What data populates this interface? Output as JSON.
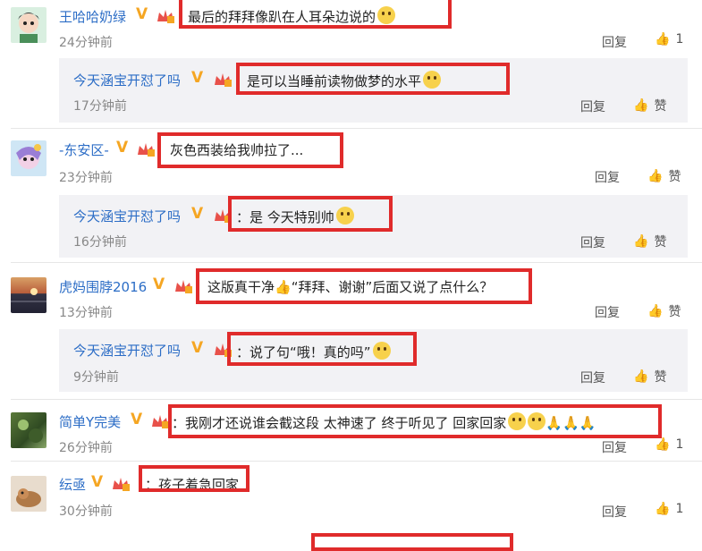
{
  "comments": [
    {
      "user": "王哈哈奶绿",
      "text": "最后的拜拜像趴在人耳朵边说的",
      "time": "24分钟前",
      "reply": "回复",
      "likes": "1"
    },
    {
      "user": "今天涵宝开怼了吗",
      "text": "是可以当睡前读物做梦的水平",
      "time": "17分钟前",
      "reply": "回复",
      "likes": "赞"
    },
    {
      "user": "-东安区-",
      "text": "灰色西装给我帅拉了...",
      "time": "23分钟前",
      "reply": "回复",
      "likes": "赞"
    },
    {
      "user": "今天涵宝开怼了吗",
      "text": "：是 今天特别帅",
      "time": "16分钟前",
      "reply": "回复",
      "likes": "赞"
    },
    {
      "user": "虎妈围脖2016",
      "text": "这版真干净",
      "text2": "“拜拜、谢谢”后面又说了点什么？",
      "time": "13分钟前",
      "reply": "回复",
      "likes": "赞"
    },
    {
      "user": "今天涵宝开怼了吗",
      "text": "：说了句“哦！真的吗”",
      "time": "9分钟前",
      "reply": "回复",
      "likes": "赞"
    },
    {
      "user": "简单Y完美",
      "text": "：我刚才还说谁会截这段 太神速了 终于听见了 回家回家",
      "time": "26分钟前",
      "reply": "回复",
      "likes": "1"
    },
    {
      "user": "纭亟",
      "text": "：孩子着急回家",
      "time": "30分钟前",
      "reply": "回复",
      "likes": "1"
    }
  ]
}
